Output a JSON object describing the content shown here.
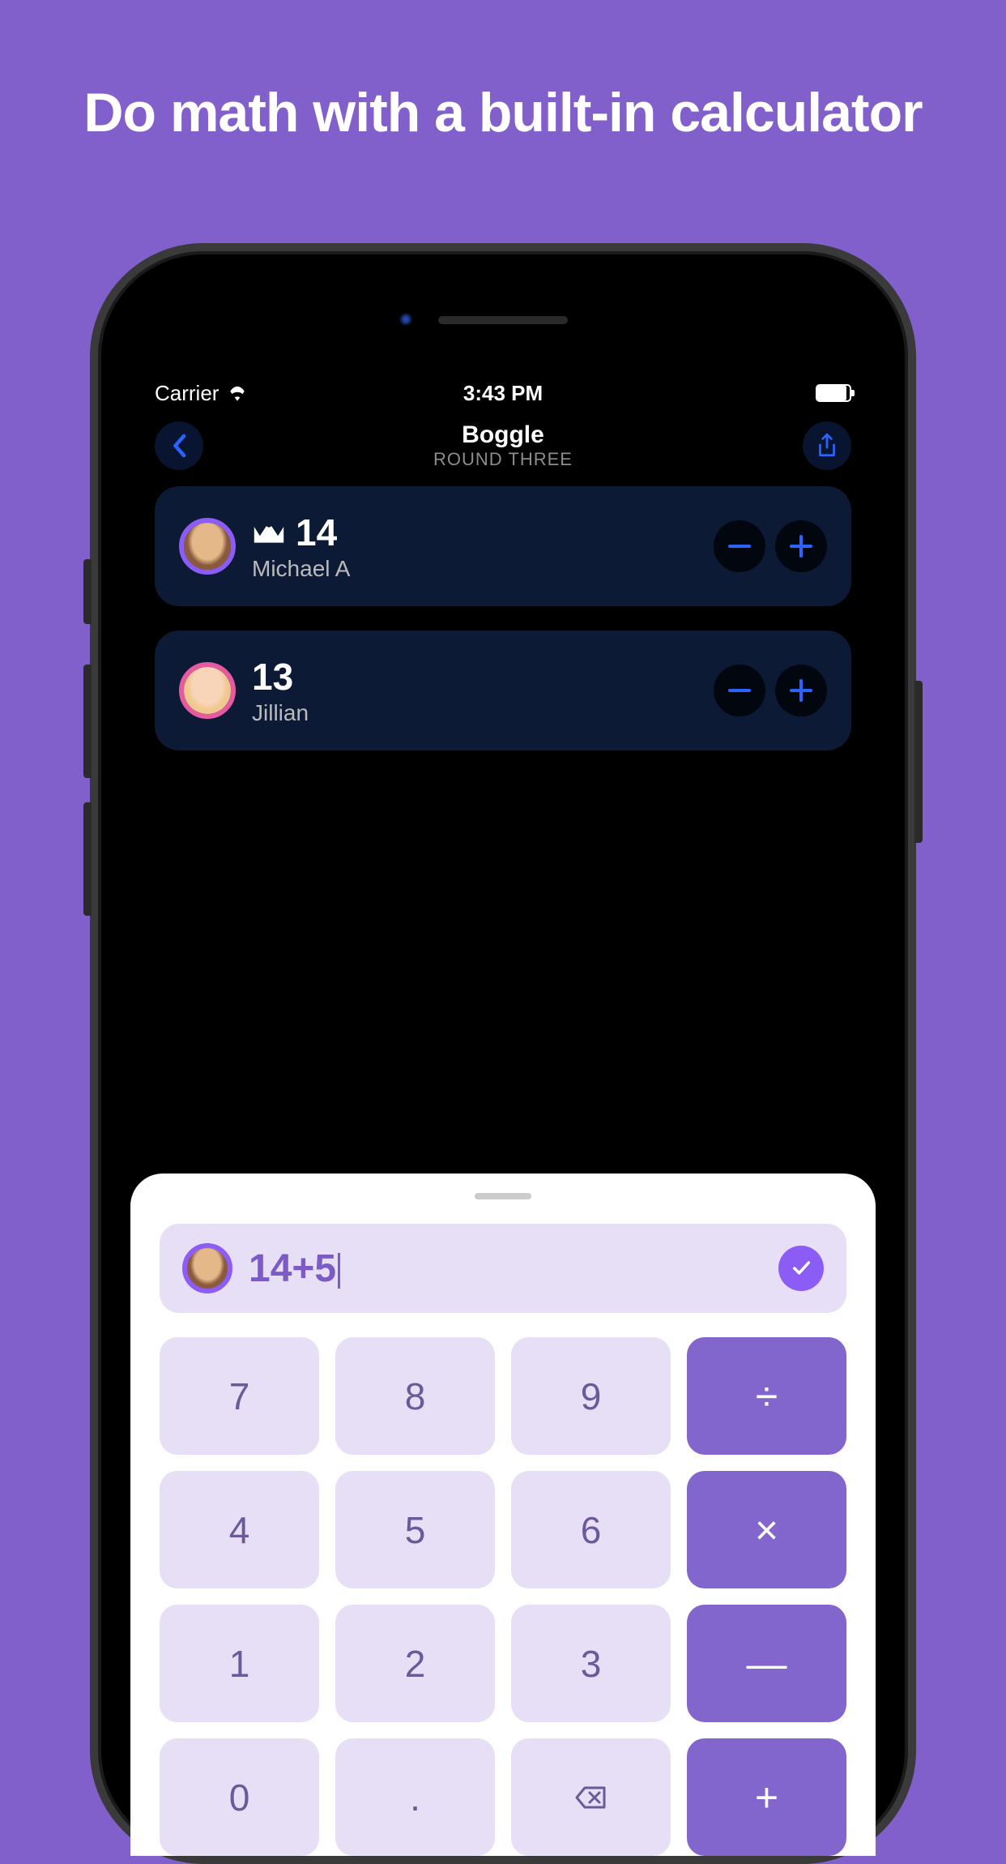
{
  "headline": "Do math with a built-in calculator",
  "status": {
    "carrier": "Carrier",
    "time": "3:43 PM"
  },
  "nav": {
    "title": "Boggle",
    "subtitle": "ROUND THREE"
  },
  "players": [
    {
      "score": "14",
      "name": "Michael A",
      "leader": true,
      "avatarColor": "purple"
    },
    {
      "score": "13",
      "name": "Jillian",
      "leader": false,
      "avatarColor": "pink"
    }
  ],
  "calc": {
    "expression": "14+5",
    "keys": [
      {
        "label": "7",
        "op": false
      },
      {
        "label": "8",
        "op": false
      },
      {
        "label": "9",
        "op": false
      },
      {
        "label": "÷",
        "op": true
      },
      {
        "label": "4",
        "op": false
      },
      {
        "label": "5",
        "op": false
      },
      {
        "label": "6",
        "op": false
      },
      {
        "label": "×",
        "op": true
      },
      {
        "label": "1",
        "op": false
      },
      {
        "label": "2",
        "op": false
      },
      {
        "label": "3",
        "op": false
      },
      {
        "label": "—",
        "op": true
      },
      {
        "label": "0",
        "op": false
      },
      {
        "label": ".",
        "op": false
      },
      {
        "label": "←",
        "op": false,
        "icon": "backspace"
      },
      {
        "label": "+",
        "op": true
      }
    ]
  }
}
